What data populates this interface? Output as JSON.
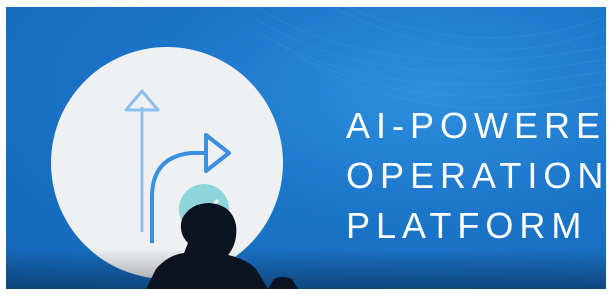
{
  "slide": {
    "headline_lines": [
      "AI-POWERED",
      "OPERATIONS",
      "PLATFORM"
    ],
    "colors": {
      "background": "#1b75c9",
      "circle": "#eef0f2",
      "arrow": "#3a8fe0",
      "check_badge": "#8fd6dc",
      "text": "#ffffff"
    },
    "icons": [
      "up-arrow-icon",
      "right-turn-arrow-icon",
      "checkmark-icon"
    ]
  }
}
